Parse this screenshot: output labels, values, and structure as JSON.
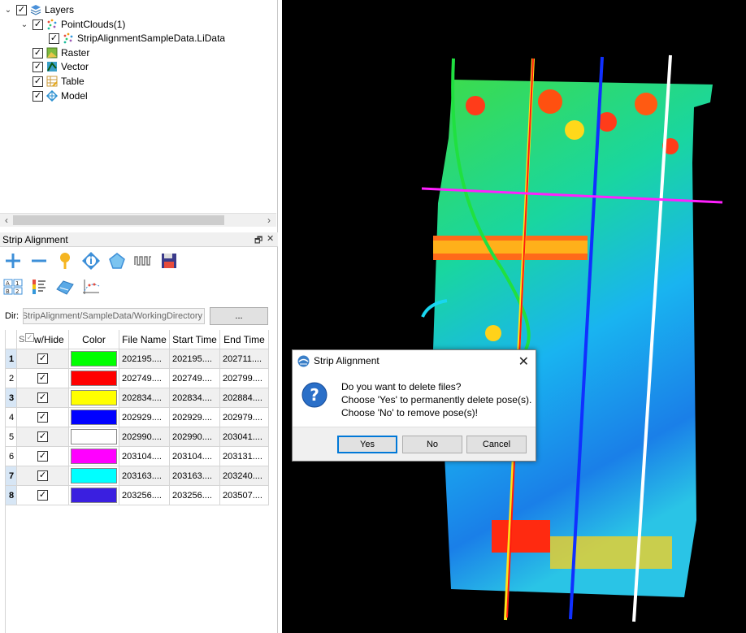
{
  "layers_tree": {
    "root": {
      "label": "Layers",
      "checked": true
    },
    "pointclouds": {
      "label": "PointClouds(1)",
      "checked": true
    },
    "dataset": {
      "label": "StripAlignmentSampleData.LiData",
      "checked": true
    },
    "raster": {
      "label": "Raster",
      "checked": true
    },
    "vector": {
      "label": "Vector",
      "checked": true
    },
    "table": {
      "label": "Table",
      "checked": true
    },
    "model": {
      "label": "Model",
      "checked": true
    }
  },
  "panel": {
    "title": "Strip Alignment",
    "float_glyph": "🗗",
    "close_glyph": "✕"
  },
  "dir": {
    "label": "Dir:",
    "value": "D/StripAlignment/SampleData/WorkingDirectory/",
    "browse_label": "..."
  },
  "grid": {
    "columns": [
      "S",
      "w/Hide",
      "Color",
      "File Name",
      "Start Time",
      "End Time"
    ],
    "rows": [
      {
        "index": "1",
        "selected": true,
        "color": "#00ff00",
        "file": "202195....",
        "start": "202195....",
        "end": "202711...."
      },
      {
        "index": "2",
        "selected": false,
        "color": "#ff0000",
        "file": "202749....",
        "start": "202749....",
        "end": "202799...."
      },
      {
        "index": "3",
        "selected": true,
        "color": "#ffff00",
        "file": "202834....",
        "start": "202834....",
        "end": "202884...."
      },
      {
        "index": "4",
        "selected": false,
        "color": "#0000ff",
        "file": "202929....",
        "start": "202929....",
        "end": "202979...."
      },
      {
        "index": "5",
        "selected": false,
        "color": "#ffffff",
        "file": "202990....",
        "start": "202990....",
        "end": "203041...."
      },
      {
        "index": "6",
        "selected": false,
        "color": "#ff00ff",
        "file": "203104....",
        "start": "203104....",
        "end": "203131...."
      },
      {
        "index": "7",
        "selected": true,
        "color": "#00ffff",
        "file": "203163....",
        "start": "203163....",
        "end": "203240...."
      },
      {
        "index": "8",
        "selected": true,
        "color": "#3a1fe0",
        "file": "203256....",
        "start": "203256....",
        "end": "203507...."
      }
    ]
  },
  "dialog": {
    "title": "Strip Alignment",
    "message_line1": "Do you want to delete files?",
    "message_line2": "Choose 'Yes' to permanently delete pose(s).",
    "message_line3": "Choose 'No' to remove pose(s)!",
    "yes_label": "Yes",
    "no_label": "No",
    "cancel_label": "Cancel"
  },
  "icons": {
    "toolbar1": [
      "add-icon",
      "remove-icon",
      "pin-icon",
      "info-icon",
      "pentagon-icon",
      "waveform-icon",
      "save-icon"
    ],
    "toolbar2": [
      "sort-icon",
      "color-scale-icon",
      "strip-icon",
      "trajectory-icon"
    ]
  }
}
